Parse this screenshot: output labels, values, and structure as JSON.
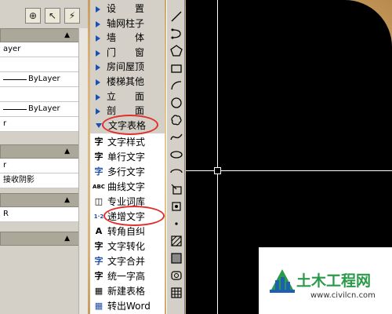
{
  "properties": {
    "rows_top": [
      {
        "text": "ayer",
        "line": false
      },
      {
        "text": "",
        "line": false
      },
      {
        "text": "ByLayer",
        "line": true
      },
      {
        "text": "",
        "line": false
      },
      {
        "text": "ByLayer",
        "line": true
      },
      {
        "text": "r",
        "line": false
      }
    ],
    "rows_mid": [
      {
        "text": "r"
      },
      {
        "text": "接收阴影"
      }
    ],
    "rows_bot": [
      {
        "text": "R"
      }
    ]
  },
  "menu": {
    "top_items": [
      "设　　置",
      "轴网柱子",
      "墙　　体",
      "门　　窗",
      "房间屋顶",
      "楼梯其他",
      "立　　面",
      "剖　　面"
    ],
    "header": "文字表格",
    "sub_items": [
      {
        "icon": "字",
        "label": "文字样式"
      },
      {
        "icon": "字",
        "label": "单行文字"
      },
      {
        "icon": "字",
        "label": "多行文字"
      },
      {
        "icon": "ABC",
        "label": "曲线文字"
      },
      {
        "icon": "◫",
        "label": "专业词库"
      },
      {
        "icon": "1·2",
        "label": "递增文字"
      },
      {
        "icon": "A",
        "label": "转角自纠"
      },
      {
        "icon": "字",
        "label": "文字转化"
      },
      {
        "icon": "字",
        "label": "文字合并"
      },
      {
        "icon": "字",
        "label": "统一字高"
      },
      {
        "icon": "▦",
        "label": "新建表格"
      },
      {
        "icon": "▦",
        "label": "转出Word"
      }
    ]
  },
  "watermark": {
    "brand": "土木工程网",
    "url": "www.civilcn.com"
  },
  "colors": {
    "highlight_circle": "#e0302e",
    "menu_arrow": "#1a4fb4",
    "canvas": "#000000",
    "brand_green": "#2a9a4a"
  }
}
